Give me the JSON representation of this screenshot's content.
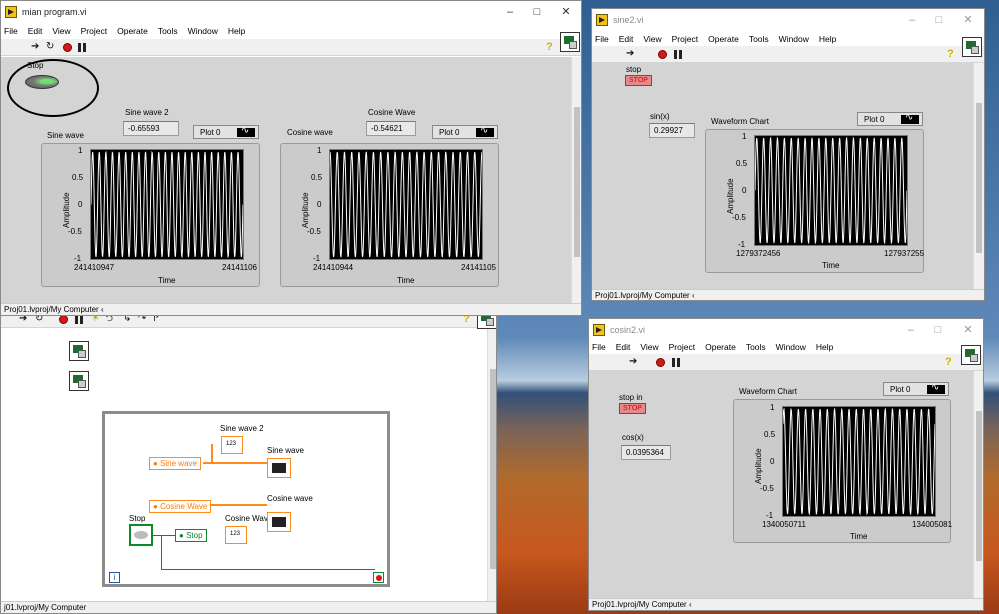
{
  "menu": [
    "File",
    "Edit",
    "View",
    "Project",
    "Operate",
    "Tools",
    "Window",
    "Help"
  ],
  "main": {
    "title": "mian program.vi",
    "stop_label": "Stop",
    "sine2_label": "Sine wave 2",
    "sine2_value": "-0.65593",
    "cos_label": "Cosine Wave",
    "cos_value": "-0.54621",
    "plot_legend": "Plot 0",
    "sine_chart": {
      "label": "Sine wave",
      "ylabel": "Amplitude",
      "xlabel": "Time",
      "x_start": "241410947",
      "x_end": "24141106"
    },
    "cos_chart": {
      "label": "Cosine wave",
      "ylabel": "Amplitude",
      "xlabel": "Time",
      "x_start": "241410944",
      "x_end": "24141105"
    },
    "status": "Proj01.lvproj/My Computer"
  },
  "sine2": {
    "title": "sine2.vi",
    "stop_label": "stop",
    "stop_btn": "STOP",
    "ind_label": "sin(x)",
    "ind_value": "0.29927",
    "chart_label": "Waveform Chart",
    "plot_legend": "Plot 0",
    "ylabel": "Amplitude",
    "xlabel": "Time",
    "x_start": "1279372456",
    "x_end": "127937255",
    "status": "Proj01.lvproj/My Computer"
  },
  "cosin2": {
    "title": "cosin2.vi",
    "stop_label": "stop in",
    "stop_btn": "STOP",
    "ind_label": "cos(x)",
    "ind_value": "0.0395364",
    "chart_label": "Waveform Chart",
    "plot_legend": "Plot 0",
    "ylabel": "Amplitude",
    "xlabel": "Time",
    "x_start": "1340050711",
    "x_end": "134005081",
    "status": "Proj01.lvproj/My Computer"
  },
  "diagram": {
    "sine2_label": "Sine wave 2",
    "sine_wave_label": "Sine wave",
    "sine_ref": "Sine wave",
    "cos_ref": "Cosine Wave",
    "cos_wave_label": "Cosine wave",
    "cos_wave2_label": "Cosine Wave",
    "stop_label": "Stop",
    "stop_ref": "Stop",
    "num_glyph": "123",
    "loop_i": "i",
    "status": "j01.lvproj/My Computer"
  },
  "y_ticks": [
    "1",
    "0.5",
    "0",
    "-0.5",
    "-1"
  ],
  "colors": {
    "front_panel": "#d4d4d4",
    "plot_bg": "#000000",
    "trace": "#ffffff",
    "wire_orange": "#ff8c1a",
    "stop_red": "#e68a8a"
  },
  "chart_data": [
    {
      "type": "line",
      "title": "Sine wave",
      "ylabel": "Amplitude",
      "xlabel": "Time",
      "ylim": [
        -1,
        1
      ],
      "x_tick_labels": [
        "241410947",
        "24141106"
      ],
      "series": [
        {
          "values": []
        }
      ]
    },
    {
      "type": "line",
      "title": "Cosine wave",
      "ylabel": "Amplitude",
      "xlabel": "Time",
      "ylim": [
        -1,
        1
      ],
      "x_tick_labels": [
        "241410944",
        "24141105"
      ],
      "series": [
        {
          "values": []
        }
      ]
    },
    {
      "type": "line",
      "title": "Waveform Chart",
      "ylabel": "Amplitude",
      "xlabel": "Time",
      "ylim": [
        -1,
        1
      ],
      "x_tick_labels": [
        "1279372456",
        "127937255"
      ],
      "series": [
        {
          "values": []
        }
      ]
    },
    {
      "type": "line",
      "title": "Waveform Chart",
      "ylabel": "Amplitude",
      "xlabel": "Time",
      "ylim": [
        -1,
        1
      ],
      "x_tick_labels": [
        "1340050711",
        "134005081"
      ],
      "series": [
        {
          "values": []
        }
      ]
    }
  ]
}
